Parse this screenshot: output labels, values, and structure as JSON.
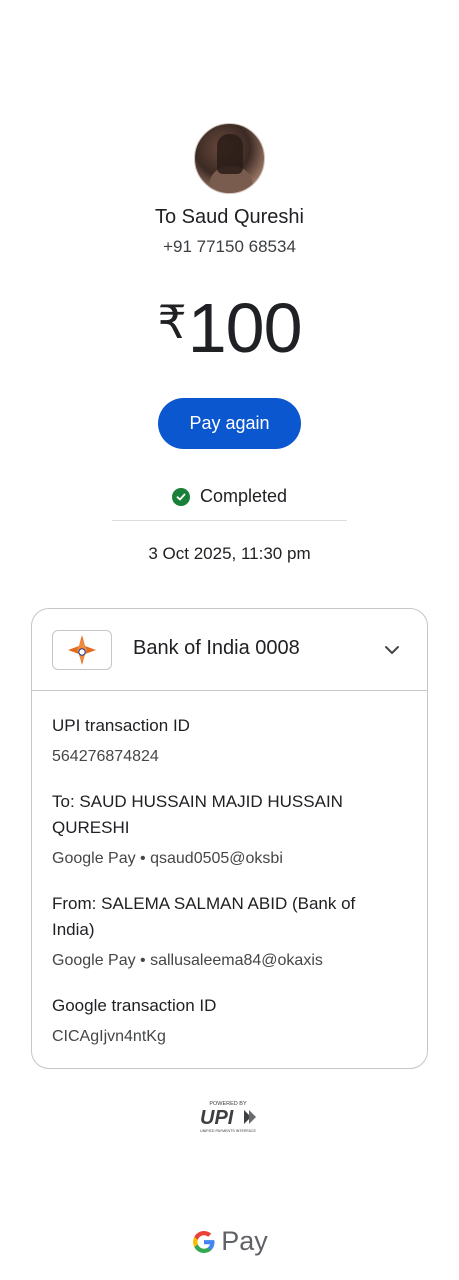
{
  "recipient": {
    "name": "To Saud Qureshi",
    "phone": "+91 77150 68534"
  },
  "amount": {
    "currency_symbol": "₹",
    "value": "100"
  },
  "actions": {
    "pay_again_label": "Pay again"
  },
  "status": {
    "text": "Completed",
    "color": "#188038"
  },
  "datetime": "3 Oct 2025, 11:30 pm",
  "bank": {
    "name": "Bank of India 0008"
  },
  "details": [
    {
      "label": "UPI transaction ID",
      "value": "564276874824"
    },
    {
      "label": "To: SAUD HUSSAIN MAJID HUSSAIN QURESHI",
      "value": "Google Pay • qsaud0505@oksbi"
    },
    {
      "label": "From: SALEMA SALMAN ABID (Bank of India)",
      "value": "Google Pay • sallusaleema84@okaxis"
    },
    {
      "label": "Google transaction ID",
      "value": "CICAgIjvn4ntKg"
    }
  ],
  "footer": {
    "upi_powered_by": "POWERED BY",
    "upi_text": "UPI",
    "upi_subtitle": "UNIFIED PAYMENTS INTERFACE",
    "gpay_text": "Pay"
  },
  "colors": {
    "accent": "#0b57d0"
  }
}
